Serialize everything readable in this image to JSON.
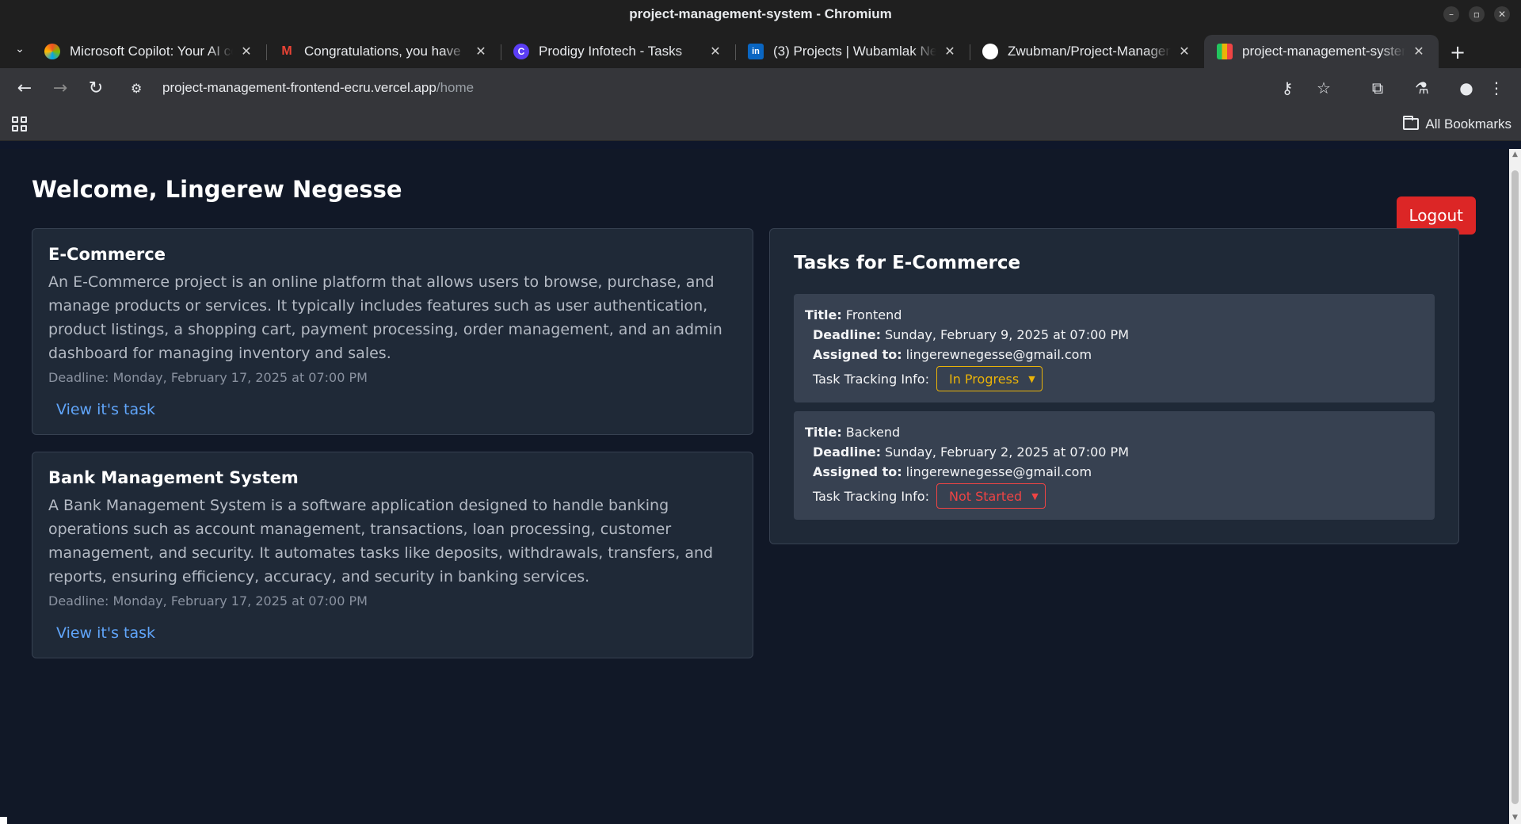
{
  "window": {
    "title": "project-management-system - Chromium",
    "controls": [
      "minimize",
      "maximize",
      "close"
    ]
  },
  "tabs": [
    {
      "title": "Microsoft Copilot: Your AI companion",
      "favicon": "copilot-icon",
      "active": false
    },
    {
      "title": "Congratulations, you have",
      "favicon": "gmail-icon",
      "active": false
    },
    {
      "title": "Prodigy Infotech - Tasks",
      "favicon": "prodigy-icon",
      "active": false
    },
    {
      "title": "(3) Projects | Wubamlak Negesse",
      "favicon": "linkedin-icon",
      "active": false
    },
    {
      "title": "Zwubman/Project-Management",
      "favicon": "github-icon",
      "active": false
    },
    {
      "title": "project-management-system",
      "favicon": "app-icon",
      "active": true
    }
  ],
  "address_bar": {
    "host": "project-management-frontend-ecru.vercel.app",
    "path": "/home"
  },
  "bookmarks_bar": {
    "all_bookmarks_label": "All Bookmarks"
  },
  "page": {
    "welcome": "Welcome, Lingerew Negesse",
    "logout_label": "Logout",
    "projects": [
      {
        "name": "E-Commerce",
        "description": "An E-Commerce project is an online platform that allows users to browse, purchase, and manage products or services. It typically includes features such as user authentication, product listings, a shopping cart, payment processing, order management, and an admin dashboard for managing inventory and sales.",
        "deadline": "Deadline: Monday, February 17, 2025 at 07:00 PM",
        "link": "View it's task"
      },
      {
        "name": "Bank Management System",
        "description": "A Bank Management System is a software application designed to handle banking operations such as account management, transactions, loan processing, customer management, and security. It automates tasks like deposits, withdrawals, transfers, and reports, ensuring efficiency, accuracy, and security in banking services.",
        "deadline": "Deadline: Monday, February 17, 2025 at 07:00 PM",
        "link": "View it's task"
      }
    ],
    "tasks_panel": {
      "heading": "Tasks for E-Commerce",
      "labels": {
        "title": "Title:",
        "deadline": "Deadline:",
        "assigned": "Assigned to:",
        "tracking": "Task Tracking Info:"
      },
      "tasks": [
        {
          "title": "Frontend",
          "deadline": "Sunday, February 9, 2025 at 07:00 PM",
          "assigned_to": "lingerewnegesse@gmail.com",
          "status": "In Progress",
          "status_color": "#eab308"
        },
        {
          "title": "Backend",
          "deadline": "Sunday, February 2, 2025 at 07:00 PM",
          "assigned_to": "lingerewnegesse@gmail.com",
          "status": "Not Started",
          "status_color": "#ef4444"
        }
      ]
    }
  },
  "colors": {
    "page_bg": "#111827",
    "card_bg": "#1f2937",
    "task_bg": "#374151",
    "logout": "#dc2626",
    "link": "#60a5fa"
  }
}
